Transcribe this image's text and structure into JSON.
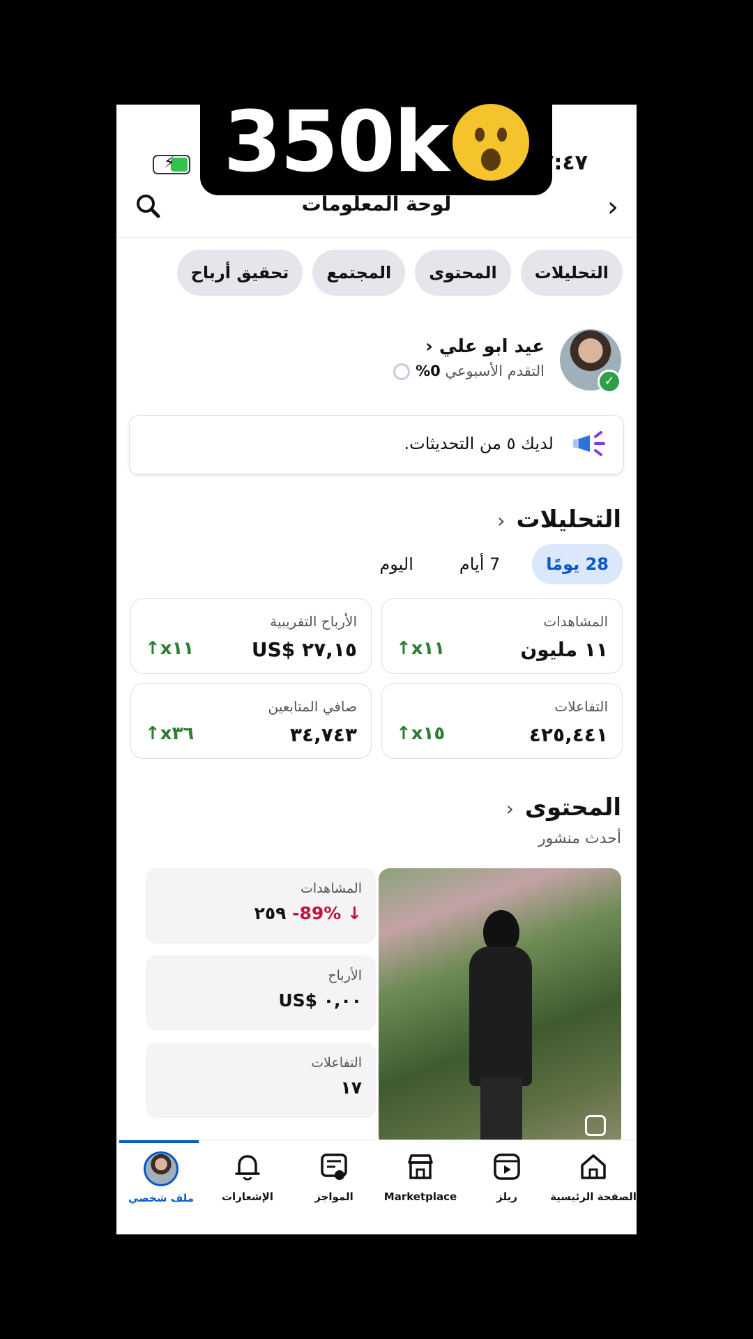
{
  "overlay": {
    "text": "350k"
  },
  "status_bar": {
    "time": "٧:٤٧"
  },
  "header": {
    "title": "لوحة المعلومات"
  },
  "tabs": [
    "التحليلات",
    "المحتوى",
    "المجتمع",
    "تحقيق أرباح"
  ],
  "profile": {
    "name": "عيد ابو علي",
    "progress_label": "التقدم الأسبوعي",
    "progress_value": "0%"
  },
  "updates": {
    "text": "لديك ٥ من التحديثات."
  },
  "analytics": {
    "title": "التحليلات",
    "periods": [
      "28 يومًا",
      "7 أيام",
      "اليوم"
    ],
    "cards": [
      {
        "label": "المشاهدات",
        "value": "١١ مليون",
        "change": "↑x١١"
      },
      {
        "label": "الأرباح التقريبية",
        "value": "US$ ٢٧,١٥",
        "change": "↑x١١"
      },
      {
        "label": "التفاعلات",
        "value": "٤٢٥,٤٤١",
        "change": "↑x١٥"
      },
      {
        "label": "صافي المتابعين",
        "value": "٣٤,٧٤٣",
        "change": "↑x٣٦"
      }
    ]
  },
  "content": {
    "title": "المحتوى",
    "subtitle": "أحدث منشور",
    "stats": [
      {
        "label": "المشاهدات",
        "value": "٢٥٩",
        "change": "-89% ↓"
      },
      {
        "label": "الأرباح",
        "value": "US$ ٠,٠٠",
        "change": ""
      },
      {
        "label": "التفاعلات",
        "value": "١٧",
        "change": ""
      }
    ]
  },
  "nav": [
    "الصفحة الرئيسية",
    "ريلز",
    "Marketplace",
    "المواجز",
    "الإشعارات",
    "ملف شخصي"
  ]
}
